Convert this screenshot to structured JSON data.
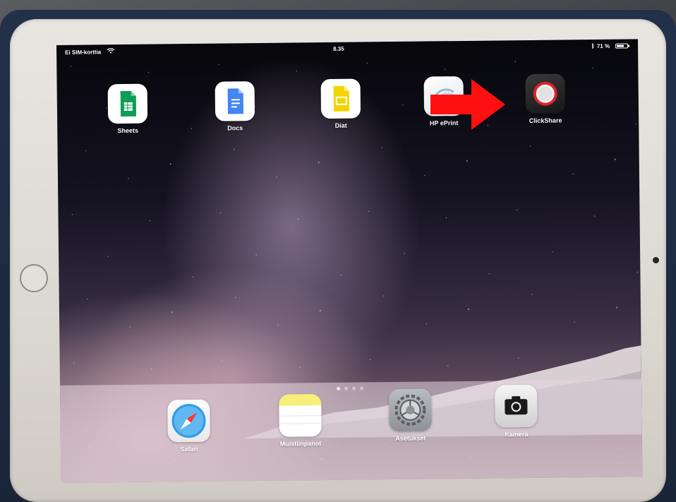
{
  "status_bar": {
    "carrier": "Ei SIM-korttia",
    "time": "8.35",
    "battery": "71 %",
    "battery_level": 0.71
  },
  "home_apps": [
    {
      "label": "Sheets",
      "icon": "sheets-icon"
    },
    {
      "label": "Docs",
      "icon": "docs-icon"
    },
    {
      "label": "Diat",
      "icon": "slides-icon"
    },
    {
      "label": "HP ePrint",
      "icon": "hp-eprint-icon"
    },
    {
      "label": "ClickShare",
      "icon": "clickshare-icon"
    }
  ],
  "page_indicator": {
    "pages": 4,
    "current": 1
  },
  "dock_apps": [
    {
      "label": "Safari",
      "icon": "safari-icon"
    },
    {
      "label": "Muistiinpanot",
      "icon": "notes-icon"
    },
    {
      "label": "Asetukset",
      "icon": "settings-icon"
    },
    {
      "label": "Kamera",
      "icon": "camera-icon"
    }
  ],
  "colors": {
    "sheets": "#0f9d58",
    "docs": "#4285f4",
    "slides": "#f4b400",
    "clickshare_ring": "#d8232a",
    "arrow": "#ff1010"
  }
}
